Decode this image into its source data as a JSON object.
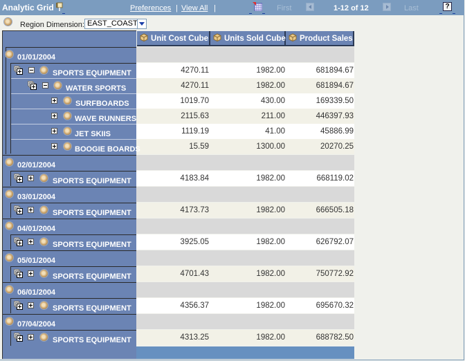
{
  "header": {
    "title": "Analytic Grid",
    "preferences_label": "Preferences",
    "view_all_label": "View All",
    "separator": "|",
    "first_label": "First",
    "count_label": "1-12 of 12",
    "last_label": "Last",
    "help_label": "?"
  },
  "region": {
    "label": "Region Dimension:",
    "value": "EAST_COAST"
  },
  "columns": [
    "Unit Cost Cube",
    "Units Sold Cube",
    "Product Sales"
  ],
  "row_labels": {
    "d1": "01/01/2004",
    "d1_se": "SPORTS EQUIPMENT",
    "d1_ws": "WATER SPORTS",
    "d1_sb": "SURFBOARDS",
    "d1_wr": "WAVE RUNNERS",
    "d1_js": "JET SKIIS",
    "d1_bb": "BOOGIE BOARDS",
    "d2": "02/01/2004",
    "d2_se": "SPORTS EQUIPMENT",
    "d3": "03/01/2004",
    "d3_se": "SPORTS EQUIPMENT",
    "d4": "04/01/2004",
    "d4_se": "SPORTS EQUIPMENT",
    "d5": "05/01/2004",
    "d5_se": "SPORTS EQUIPMENT",
    "d6": "06/01/2004",
    "d6_se": "SPORTS EQUIPMENT",
    "d7": "07/04/2004",
    "d7_se": "SPORTS EQUIPMENT"
  },
  "rows": {
    "d1_se": [
      "4270.11",
      "1982.00",
      "681894.67"
    ],
    "d1_ws": [
      "4270.11",
      "1982.00",
      "681894.67"
    ],
    "d1_sb": [
      "1019.70",
      "430.00",
      "169339.50"
    ],
    "d1_wr": [
      "2115.63",
      "211.00",
      "446397.93"
    ],
    "d1_js": [
      "1119.19",
      "41.00",
      "45886.99"
    ],
    "d1_bb": [
      "15.59",
      "1300.00",
      "20270.25"
    ],
    "d2_se": [
      "4183.84",
      "1982.00",
      "668119.02"
    ],
    "d3_se": [
      "4173.73",
      "1982.00",
      "666505.18"
    ],
    "d4_se": [
      "3925.05",
      "1982.00",
      "626792.07"
    ],
    "d5_se": [
      "4701.43",
      "1982.00",
      "750772.92"
    ],
    "d6_se": [
      "4356.37",
      "1982.00",
      "695670.32"
    ],
    "d7_se": [
      "4313.25",
      "1982.00",
      "688782.50"
    ]
  }
}
